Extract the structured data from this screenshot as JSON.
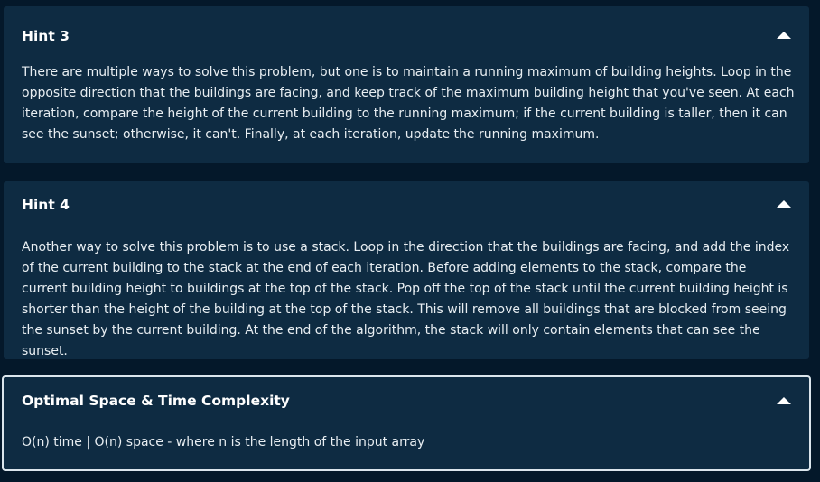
{
  "hints": [
    {
      "title": "Hint 3",
      "body": "There are multiple ways to solve this problem, but one is to maintain a running maximum of building heights. Loop in the opposite direction that the buildings are facing, and keep track of the maximum building height that you've seen. At each iteration, compare the height of the current building to the running maximum; if the current building is taller, then it can see the sunset; otherwise, it can't. Finally, at each iteration, update the running maximum.",
      "toggle_icon": "caret-up-icon"
    },
    {
      "title": "Hint 4",
      "body": "Another way to solve this problem is to use a stack. Loop in the direction that the buildings are facing, and add the index of the current building to the stack at the end of each iteration. Before adding elements to the stack, compare the current building height to buildings at the top of the stack. Pop off the top of the stack until the current building height is shorter than the height of the building at the top of the stack. This will remove all buildings that are blocked from seeing the sunset by the current building. At the end of the algorithm, the stack will only contain elements that can see the sunset.",
      "toggle_icon": "caret-up-icon"
    }
  ],
  "complexity": {
    "title": "Optimal Space & Time Complexity",
    "body": "O(n) time | O(n) space - where n is the length of the input array",
    "toggle_icon": "caret-up-icon"
  },
  "colors": {
    "page_background": "#04182a",
    "panel_background": "#0e2b42",
    "focus_border": "#dbe5ec",
    "text": "#ffffff"
  }
}
